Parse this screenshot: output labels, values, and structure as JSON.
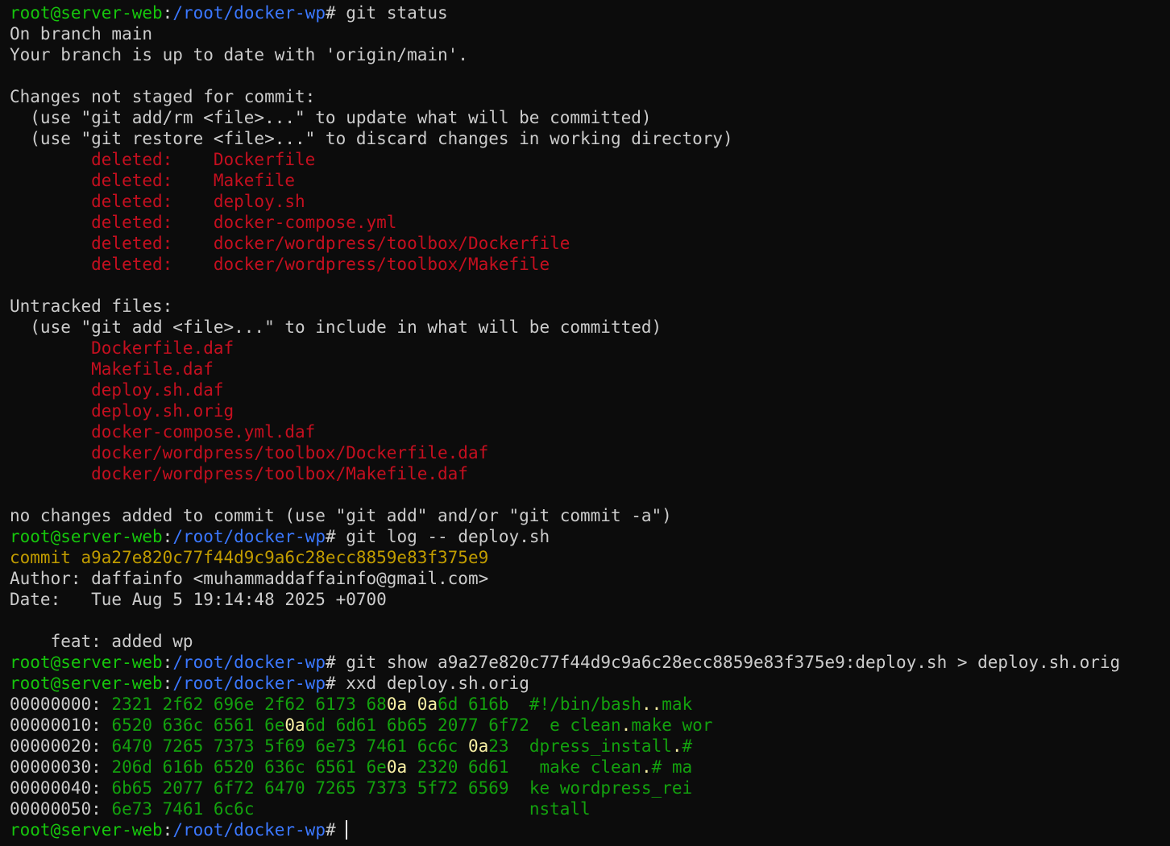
{
  "prompt": {
    "user": "root@server-web",
    "sep": ":",
    "path": "/root/docker-wp",
    "symbol": "# "
  },
  "cmd1": "git status",
  "status": {
    "branch": "On branch main",
    "uptodate": "Your branch is up to date with 'origin/main'.",
    "not_staged_header": "Changes not staged for commit:",
    "hint_add_rm": "  (use \"git add/rm <file>...\" to update what will be committed)",
    "hint_restore": "  (use \"git restore <file>...\" to discard changes in working directory)",
    "deleted": [
      "        deleted:    Dockerfile",
      "        deleted:    Makefile",
      "        deleted:    deploy.sh",
      "        deleted:    docker-compose.yml",
      "        deleted:    docker/wordpress/toolbox/Dockerfile",
      "        deleted:    docker/wordpress/toolbox/Makefile"
    ],
    "untracked_header": "Untracked files:",
    "hint_add": "  (use \"git add <file>...\" to include in what will be committed)",
    "untracked": [
      "        Dockerfile.daf",
      "        Makefile.daf",
      "        deploy.sh.daf",
      "        deploy.sh.orig",
      "        docker-compose.yml.daf",
      "        docker/wordpress/toolbox/Dockerfile.daf",
      "        docker/wordpress/toolbox/Makefile.daf"
    ],
    "no_changes": "no changes added to commit (use \"git add\" and/or \"git commit -a\")"
  },
  "cmd2": "git log -- deploy.sh",
  "log": {
    "commit": "commit a9a27e820c77f44d9c9a6c28ecc8859e83f375e9",
    "author": "Author: daffainfo <muhammaddaffainfo@gmail.com>",
    "date": "Date:   Tue Aug 5 19:14:48 2025 +0700",
    "message": "    feat: added wp"
  },
  "cmd3": "git show a9a27e820c77f44d9c9a6c28ecc8859e83f375e9:deploy.sh > deploy.sh.orig",
  "cmd4": "xxd deploy.sh.orig",
  "xxd": [
    {
      "offset": "00000000",
      "hex": [
        [
          "2321 2f62 696e 2f62 6173 68",
          "g"
        ],
        [
          "0a",
          "h"
        ],
        [
          " ",
          "g"
        ],
        [
          "0a",
          "h"
        ],
        [
          "6d 616b",
          "g"
        ]
      ],
      "ascii": [
        [
          "#!/bin/bash",
          "g"
        ],
        [
          "..",
          "h"
        ],
        [
          "mak",
          "g"
        ]
      ]
    },
    {
      "offset": "00000010",
      "hex": [
        [
          "6520 636c 6561 6e",
          "g"
        ],
        [
          "0a",
          "h"
        ],
        [
          "6d 6d61 6b65 2077 6f72",
          "g"
        ]
      ],
      "ascii": [
        [
          "e clean",
          "g"
        ],
        [
          ".",
          "h"
        ],
        [
          "make wor",
          "g"
        ]
      ]
    },
    {
      "offset": "00000020",
      "hex": [
        [
          "6470 7265 7373 5f69 6e73 7461 6c6c ",
          "g"
        ],
        [
          "0a",
          "h"
        ],
        [
          "23",
          "g"
        ]
      ],
      "ascii": [
        [
          "dpress_install",
          "g"
        ],
        [
          ".",
          "h"
        ],
        [
          "#",
          "g"
        ]
      ]
    },
    {
      "offset": "00000030",
      "hex": [
        [
          "206d 616b 6520 636c 6561 6e",
          "g"
        ],
        [
          "0a",
          "h"
        ],
        [
          " 2320 6d61",
          "g"
        ]
      ],
      "ascii": [
        [
          " make clean",
          "g"
        ],
        [
          ".",
          "h"
        ],
        [
          "# ma",
          "g"
        ]
      ]
    },
    {
      "offset": "00000040",
      "hex": [
        [
          "6b65 2077 6f72 6470 7265 7373 5f72 6569",
          "g"
        ]
      ],
      "ascii": [
        [
          "ke wordpress_rei",
          "g"
        ]
      ]
    },
    {
      "offset": "00000050",
      "hex": [
        [
          "6e73 7461 6c6c",
          "g"
        ]
      ],
      "ascii": [
        [
          "nstall",
          "g"
        ]
      ]
    }
  ],
  "colors": {
    "background": "#0c0c0c",
    "foreground": "#cccccc",
    "prompt_user": "#16c60c",
    "prompt_path": "#3b78ff",
    "deleted_untracked": "#c50f1f",
    "commit_hash": "#c19c00",
    "xxd_bytes": "#13a10e",
    "newline_highlight": "#f9f1a5"
  }
}
